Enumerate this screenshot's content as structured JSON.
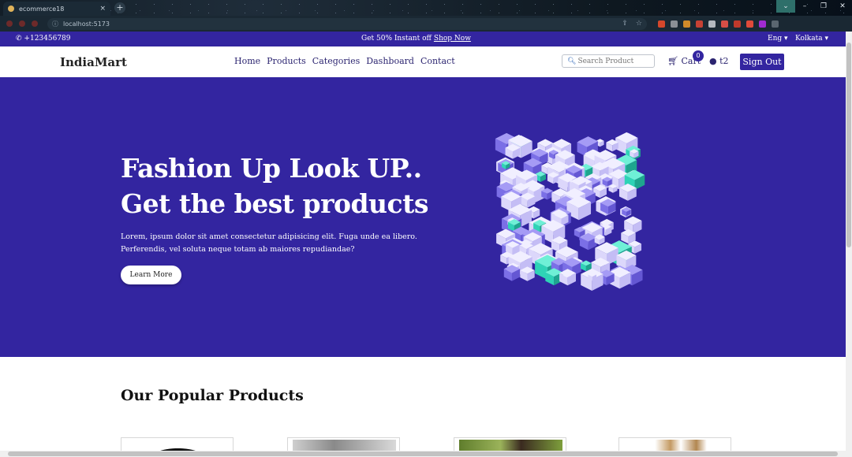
{
  "browser": {
    "tab_title": "ecommerce18",
    "tab_close": "×",
    "new_tab": "+",
    "url": "localhost:5173",
    "window_controls": [
      "⌄",
      "–",
      "❐",
      "✕"
    ],
    "extension_colors": [
      "#d4472b",
      "#8a8f96",
      "#d08a2a",
      "#c64134",
      "#b3b8bf",
      "#d74e46",
      "#c0392b",
      "#e04a3a",
      "#a02bd1",
      "#5a6670"
    ]
  },
  "topbar": {
    "phone": "+123456789",
    "phone_icon": "phone-icon",
    "promo_text": "Get 50% Instant off",
    "promo_link": "Shop Now",
    "language": "Eng ▾",
    "city": "Kolkata ▾"
  },
  "nav": {
    "logo": "IndiaMart",
    "menu": [
      "Home",
      "Products",
      "Categories",
      "Dashboard",
      "Contact"
    ],
    "search_placeholder": "Search Product",
    "cart_label": "Cart",
    "cart_count": "0",
    "user_name": "t2",
    "signout_label": "Sign Out"
  },
  "hero": {
    "headline_1": "Fashion Up Look UP..",
    "headline_2": "Get the best products",
    "description": "Lorem, ipsum dolor sit amet consectetur adipisicing elit. Fuga unde ea libero. Perferendis, vel soluta neque totam ab maiores repudiandae?",
    "button_label": "Learn More"
  },
  "popular": {
    "title": "Our Popular Products"
  },
  "colors": {
    "brand": "#3325a0",
    "accent_teal": "#2fd3b6"
  }
}
